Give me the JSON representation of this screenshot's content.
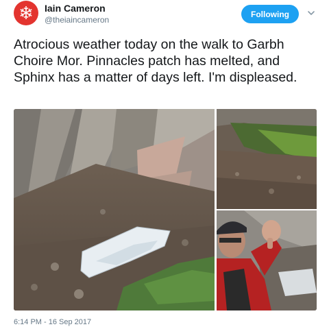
{
  "author": {
    "name": "Iain Cameron",
    "handle": "@theiaincameron",
    "avatar_icon": "snowflake-icon",
    "avatar_color": "#e3342f"
  },
  "follow_button": {
    "label": "Following",
    "color": "#1da1f2"
  },
  "more_menu_icon": "chevron-down-icon",
  "tweet_text": "Atrocious weather today on the walk to Garbh Choire Mor. Pinnacles patch has melted, and Sphinx has a matter of days left. I'm displeased.",
  "media": [
    {
      "name": "snow-patch-on-scree-photo"
    },
    {
      "name": "grassy-slope-photo"
    },
    {
      "name": "thumbs-down-selfie-photo"
    }
  ],
  "timestamp": "6:14 PM - 16 Sep 2017"
}
